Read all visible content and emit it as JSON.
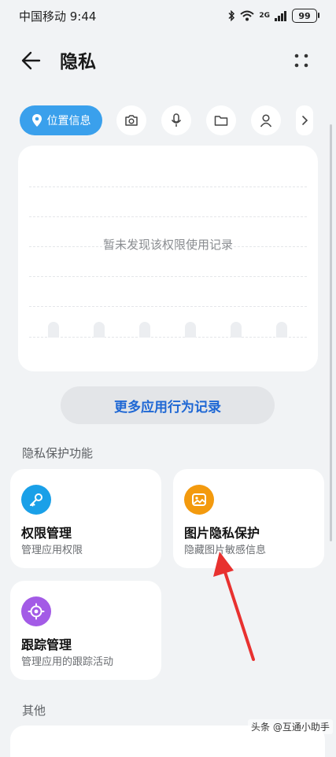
{
  "status_bar": {
    "carrier_time": "中国移动 9:44",
    "network": "2G",
    "battery": "99",
    "icons": [
      "bluetooth-icon",
      "wifi-icon",
      "signal-icon",
      "battery-icon"
    ]
  },
  "header": {
    "title": "隐私",
    "back_icon": "arrow-left-icon",
    "more_icon": "four-dots-icon"
  },
  "permission_chips": {
    "active_label": "位置信息",
    "active_icon": "location-pin-icon",
    "active_color": "#3aa0ec",
    "others": [
      "camera-icon",
      "microphone-icon",
      "folder-icon",
      "contacts-icon",
      "chevron-right-icon"
    ]
  },
  "usage_card": {
    "empty_text": "暂未发现该权限使用记录"
  },
  "more_records_button": "更多应用行为记录",
  "privacy_section": {
    "title": "隐私保护功能",
    "features": [
      {
        "title": "权限管理",
        "desc": "管理应用权限",
        "icon": "key-icon",
        "color": "#1aa0e8"
      },
      {
        "title": "图片隐私保护",
        "desc": "隐藏图片敏感信息",
        "icon": "image-icon",
        "color": "#f39a0e"
      },
      {
        "title": "跟踪管理",
        "desc": "管理应用的跟踪活动",
        "icon": "crosshair-icon",
        "color": "#a35be6"
      }
    ]
  },
  "other_section": {
    "title": "其他"
  },
  "annotation": {
    "color": "#e8312f"
  },
  "watermark": "头条 @互通小助手"
}
